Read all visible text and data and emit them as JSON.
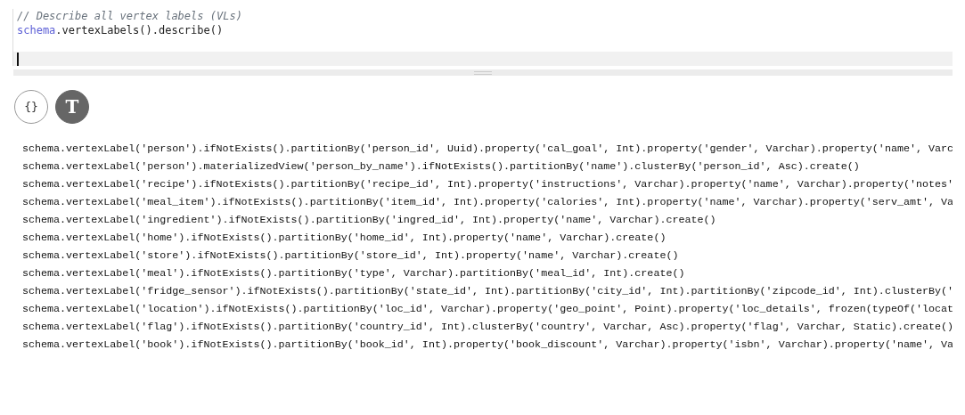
{
  "editor": {
    "lines": [
      {
        "kind": "comment",
        "parts": [
          {
            "kind": "comment",
            "text": "// Describe all vertex labels (VLs)"
          }
        ]
      },
      {
        "kind": "code",
        "parts": [
          {
            "kind": "keyword",
            "text": "schema"
          },
          {
            "kind": "plain",
            "text": ".vertexLabels().describe()"
          }
        ]
      },
      {
        "kind": "blank"
      },
      {
        "kind": "cursor",
        "active": true
      }
    ]
  },
  "view_toggles": [
    {
      "kind": "json",
      "label": "{}",
      "selected": false
    },
    {
      "kind": "text",
      "label": "T",
      "selected": true
    }
  ],
  "output_lines": [
    "schema.vertexLabel('person').ifNotExists().partitionBy('person_id', Uuid).property('cal_goal', Int).property('gender', Varchar).property('name', Varc",
    "schema.vertexLabel('person').materializedView('person_by_name').ifNotExists().partitionBy('name').clusterBy('person_id', Asc).create()",
    "schema.vertexLabel('recipe').ifNotExists().partitionBy('recipe_id', Int).property('instructions', Varchar).property('name', Varchar).property('notes'",
    "schema.vertexLabel('meal_item').ifNotExists().partitionBy('item_id', Int).property('calories', Int).property('name', Varchar).property('serv_amt', Va",
    "schema.vertexLabel('ingredient').ifNotExists().partitionBy('ingred_id', Int).property('name', Varchar).create()",
    "schema.vertexLabel('home').ifNotExists().partitionBy('home_id', Int).property('name', Varchar).create()",
    "schema.vertexLabel('store').ifNotExists().partitionBy('store_id', Int).property('name', Varchar).create()",
    "schema.vertexLabel('meal').ifNotExists().partitionBy('type', Varchar).partitionBy('meal_id', Int).create()",
    "schema.vertexLabel('fridge_sensor').ifNotExists().partitionBy('state_id', Int).partitionBy('city_id', Int).partitionBy('zipcode_id', Int).clusterBy('",
    "schema.vertexLabel('location').ifNotExists().partitionBy('loc_id', Varchar).property('geo_point', Point).property('loc_details', frozen(typeOf('locat",
    "schema.vertexLabel('flag').ifNotExists().partitionBy('country_id', Int).clusterBy('country', Varchar, Asc).property('flag', Varchar, Static).create()",
    "schema.vertexLabel('book').ifNotExists().partitionBy('book_id', Int).property('book_discount', Varchar).property('isbn', Varchar).property('name', Va"
  ]
}
